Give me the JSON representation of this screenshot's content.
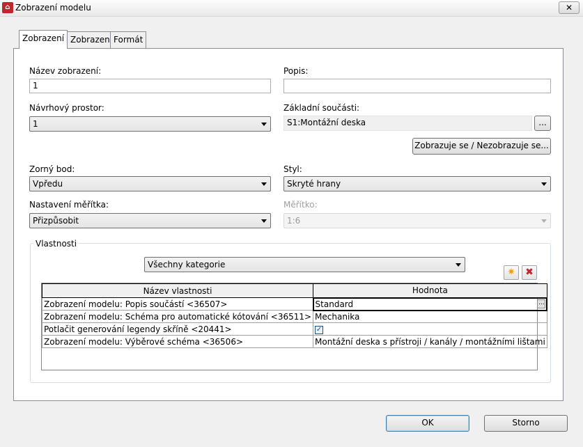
{
  "window": {
    "title": "Zobrazení modelu",
    "close_glyph": "✕"
  },
  "tabs": [
    {
      "label": "Zobrazení",
      "active": true
    },
    {
      "label": "Zobrazení",
      "active": false
    },
    {
      "label": "Formát",
      "active": false
    }
  ],
  "form": {
    "view_name": {
      "label": "Název zobrazení:",
      "value": "1"
    },
    "description": {
      "label": "Popis:",
      "value": ""
    },
    "design_space": {
      "label": "Návrhový prostor:",
      "value": "1"
    },
    "base_parts": {
      "label": "Základní součásti:",
      "value": "S1:Montážní deska",
      "browse_label": "..."
    },
    "show_hide_button": "Zobrazuje se / Nezobrazuje se...",
    "viewpoint": {
      "label": "Zorný bod:",
      "value": "Vpředu"
    },
    "style": {
      "label": "Styl:",
      "value": "Skryté hrany"
    },
    "scale_setting": {
      "label": "Nastavení měřítka:",
      "value": "Přizpůsobit"
    },
    "scale": {
      "label": "Měřítko:",
      "value": "1:6",
      "disabled": true
    }
  },
  "properties": {
    "group_label": "Vlastnosti",
    "category_filter": "Všechny kategorie",
    "add_icon": "star-add-icon",
    "delete_icon": "delete-x-icon",
    "columns": [
      "Název vlastnosti",
      "Hodnota"
    ],
    "rows": [
      {
        "name": "Zobrazení modelu: Popis součástí <36507>",
        "value": "Standard",
        "editing": true,
        "ellipsis": "..."
      },
      {
        "name": "Zobrazení modelu: Schéma pro automatické kótování <36511>",
        "value": "Mechanika"
      },
      {
        "name": "Potlačit generování legendy skříně <20441>",
        "value": "",
        "checkbox": true,
        "checked": true
      },
      {
        "name": "Zobrazení modelu: Výběrové schéma <36506>",
        "value": "Montážní deska s přístroji / kanály / montážními lištami"
      }
    ]
  },
  "footer": {
    "ok_label": "OK",
    "cancel_label": "Storno"
  },
  "colors": {
    "app_icon": "#c0262d",
    "delete_icon": "#c0262d",
    "add_icon": "#f0a000"
  }
}
